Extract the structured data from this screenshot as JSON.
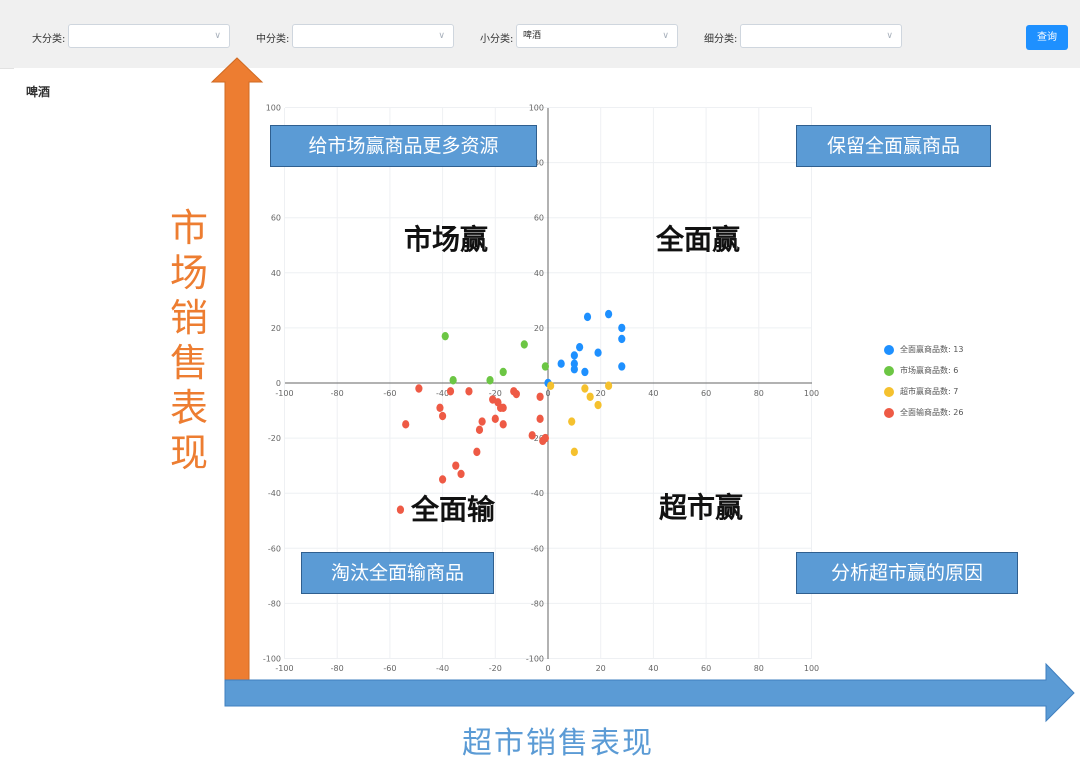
{
  "filters": {
    "category_large": {
      "label": "大分类:",
      "value": ""
    },
    "category_medium": {
      "label": "中分类:",
      "value": ""
    },
    "category_small": {
      "label": "小分类:",
      "value": "啤酒"
    },
    "category_detail": {
      "label": "细分类:",
      "value": ""
    },
    "query_button": "查询"
  },
  "panel_title": "啤酒",
  "chart_data": {
    "type": "scatter",
    "xlim": [
      -100,
      100
    ],
    "ylim": [
      -100,
      100
    ],
    "x_ticks": [
      -100,
      -80,
      -60,
      -40,
      -20,
      0,
      20,
      40,
      60,
      80,
      100
    ],
    "y_ticks": [
      -100,
      -80,
      -60,
      -40,
      -20,
      0,
      20,
      40,
      60,
      80,
      100
    ],
    "grid": true,
    "legend_position": "right",
    "series": [
      {
        "name": "全面赢商品数: 13",
        "color": "#1e90ff",
        "points": [
          [
            0,
            0
          ],
          [
            5,
            7
          ],
          [
            10,
            10
          ],
          [
            10,
            5
          ],
          [
            12,
            13
          ],
          [
            14,
            4
          ],
          [
            15,
            24
          ],
          [
            19,
            11
          ],
          [
            23,
            25
          ],
          [
            28,
            20
          ],
          [
            28,
            16
          ],
          [
            28,
            6
          ],
          [
            10,
            7
          ]
        ]
      },
      {
        "name": "市场赢商品数: 6",
        "color": "#6cc644",
        "points": [
          [
            -39,
            17
          ],
          [
            -36,
            1
          ],
          [
            -22,
            1
          ],
          [
            -17,
            4
          ],
          [
            -9,
            14
          ],
          [
            -1,
            6
          ]
        ]
      },
      {
        "name": "超市赢商品数: 7",
        "color": "#f5c12e",
        "points": [
          [
            1,
            -1
          ],
          [
            14,
            -2
          ],
          [
            16,
            -5
          ],
          [
            19,
            -8
          ],
          [
            23,
            -1
          ],
          [
            9,
            -14
          ],
          [
            10,
            -25
          ]
        ]
      },
      {
        "name": "全面输商品数: 26",
        "color": "#ee5a45",
        "points": [
          [
            -56,
            -46
          ],
          [
            -54,
            -15
          ],
          [
            -49,
            -2
          ],
          [
            -41,
            -9
          ],
          [
            -40,
            -12
          ],
          [
            -40,
            -35
          ],
          [
            -37,
            -3
          ],
          [
            -35,
            -30
          ],
          [
            -33,
            -33
          ],
          [
            -30,
            -3
          ],
          [
            -27,
            -25
          ],
          [
            -26,
            -17
          ],
          [
            -25,
            -14
          ],
          [
            -21,
            -6
          ],
          [
            -20,
            -13
          ],
          [
            -19,
            -7
          ],
          [
            -18,
            -9
          ],
          [
            -17,
            -9
          ],
          [
            -17,
            -15
          ],
          [
            -13,
            -3
          ],
          [
            -12,
            -4
          ],
          [
            -6,
            -19
          ],
          [
            -3,
            -5
          ],
          [
            -3,
            -13
          ],
          [
            -2,
            -21
          ],
          [
            -1,
            -20
          ]
        ]
      }
    ]
  },
  "quadrants": {
    "top_left": "市场赢",
    "top_right": "全面赢",
    "bottom_left": "全面输",
    "bottom_right": "超市赢"
  },
  "callouts": {
    "top_left": "给市场赢商品更多资源",
    "top_right": "保留全面赢商品",
    "bottom_left": "淘汰全面输商品",
    "bottom_right": "分析超市赢的原因"
  },
  "axis_titles": {
    "x": "超市销售表现",
    "y": "市场销售表现"
  },
  "colors": {
    "accent": "#1e90ff",
    "x_arrow": "#5b9bd5",
    "y_arrow": "#ed7d31",
    "callout_bg": "#5b9bd5"
  }
}
